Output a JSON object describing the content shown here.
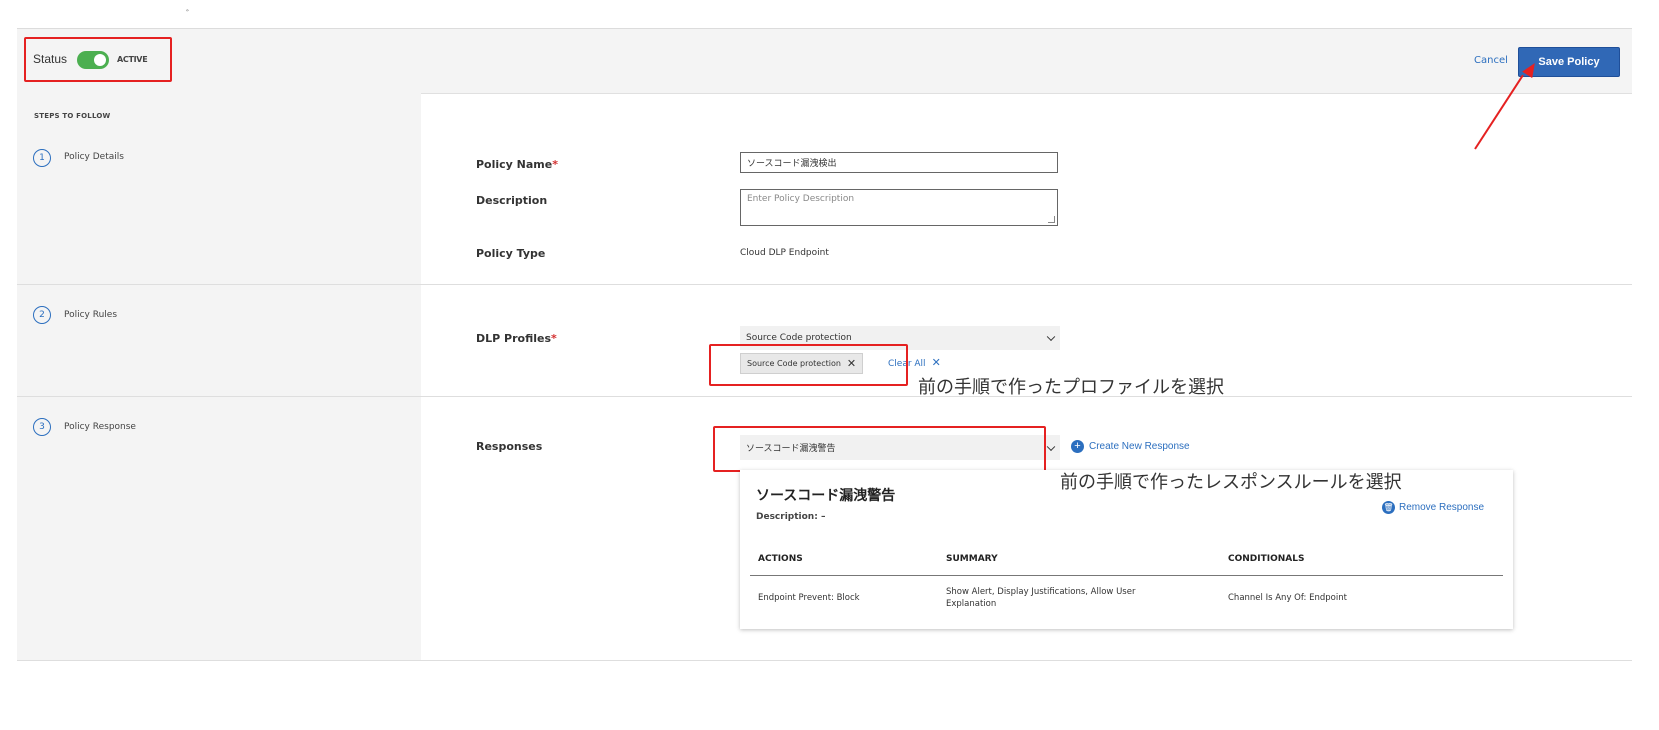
{
  "header": {
    "status_label": "Status",
    "status_value": "ACTIVE",
    "status_on": true,
    "cancel_label": "Cancel",
    "save_label": "Save Policy"
  },
  "sidebar": {
    "title": "STEPS TO FOLLOW",
    "steps": [
      {
        "number": "1",
        "label": "Policy Details"
      },
      {
        "number": "2",
        "label": "Policy Rules"
      },
      {
        "number": "3",
        "label": "Policy Response"
      }
    ]
  },
  "details": {
    "policy_name_label": "Policy Name",
    "policy_name_value": "ソースコード漏洩検出",
    "description_label": "Description",
    "description_placeholder": "Enter Policy Description",
    "policy_type_label": "Policy Type",
    "policy_type_value": "Cloud DLP Endpoint"
  },
  "rules": {
    "dlp_profiles_label": "DLP Profiles",
    "dlp_profiles_selected": "Source Code protection",
    "tag_label": "Source Code protection",
    "clear_all_label": "Clear All"
  },
  "responses": {
    "label": "Responses",
    "selected": "ソースコード漏洩警告",
    "create_new_label": "Create New Response",
    "card": {
      "title": "ソースコード漏洩警告",
      "description": "Description: –",
      "remove_label": "Remove Response",
      "columns": [
        "ACTIONS",
        "SUMMARY",
        "CONDITIONALS"
      ],
      "row": {
        "actions": "Endpoint Prevent: Block",
        "summary": "Show Alert, Display Justifications, Allow User Explanation",
        "conditionals": "Channel Is Any Of: Endpoint"
      }
    }
  },
  "annotations": {
    "profile_note": "前の手順で作ったプロファイルを選択",
    "response_note": "前の手順で作ったレスポンスルールを選択"
  },
  "colors": {
    "accent": "#3068b6",
    "link": "#2c6fbf",
    "toggle_on": "#4caf50",
    "annotation_red": "#e52121"
  }
}
